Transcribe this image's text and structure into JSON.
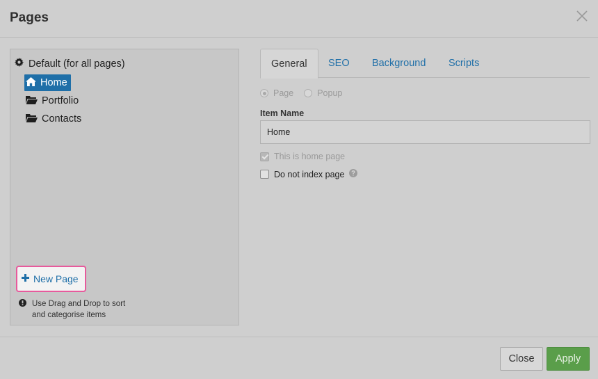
{
  "dialog": {
    "title": "Pages",
    "close_icon": "close-icon"
  },
  "tree": {
    "root_label": "Default (for all pages)",
    "root_icon": "gear-icon",
    "items": [
      {
        "label": "Home",
        "icon": "home-icon",
        "active": true
      },
      {
        "label": "Portfolio",
        "icon": "folder-open-icon",
        "active": false
      },
      {
        "label": "Contacts",
        "icon": "folder-open-icon",
        "active": false
      }
    ]
  },
  "new_page": {
    "label": "New Page",
    "icon": "plus-icon"
  },
  "hint": {
    "line1": "Use Drag and Drop to sort",
    "line2": "and categorise items",
    "icon": "exclamation-circle-icon"
  },
  "tabs": [
    {
      "label": "General",
      "active": true
    },
    {
      "label": "SEO",
      "active": false
    },
    {
      "label": "Background",
      "active": false
    },
    {
      "label": "Scripts",
      "active": false
    }
  ],
  "form": {
    "type_options": [
      {
        "label": "Page",
        "checked": true
      },
      {
        "label": "Popup",
        "checked": false
      }
    ],
    "item_name_label": "Item Name",
    "item_name_value": "Home",
    "home_page_label": "This is home page",
    "home_page_checked": true,
    "no_index_label": "Do not index page",
    "no_index_checked": false,
    "help_icon": "question-circle-icon"
  },
  "footer": {
    "close_label": "Close",
    "apply_label": "Apply"
  },
  "colors": {
    "accent_blue": "#1f6fa8",
    "highlight_pink": "#e75a9c",
    "apply_green": "#5a9e4a"
  }
}
